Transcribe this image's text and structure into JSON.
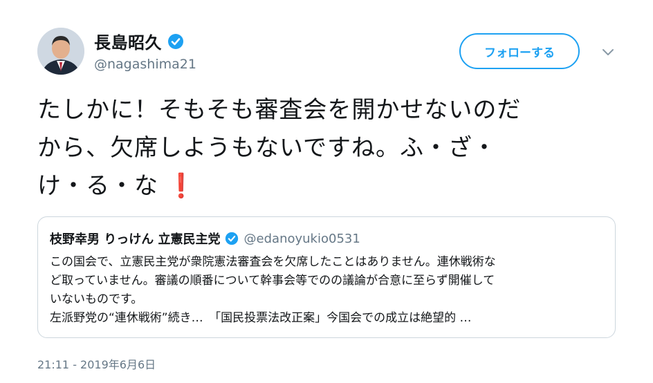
{
  "author": {
    "display_name": "長島昭久",
    "handle": "@nagashima21"
  },
  "follow_button_label": "フォローする",
  "tweet": {
    "lines": [
      "たしかに！そもそも審査会を開かせないのだ",
      "から、欠席しようもないですね。ふ・ざ・",
      "け・る・な"
    ],
    "emoji": "❗"
  },
  "quoted_tweet": {
    "display_name": "枝野幸男 りっけん 立憲民主党",
    "handle": "@edanoyukio0531",
    "lines": [
      "この国会で、立憲民主党が衆院憲法審査会を欠席したことはありません。連休戦術な",
      "ど取っていません。審議の順番について幹事会等でのの議論が合意に至らず開催して",
      "いないものです。",
      "左派野党の“連休戦術”続き…　「国民投票法改正案」今国会での成立は絶望的 …"
    ]
  },
  "timestamp": "21:11 - 2019年6月6日",
  "colors": {
    "accent": "#1da1f2",
    "text": "#14171a",
    "secondary": "#657786",
    "border": "#ccd6dd",
    "exclamation": "#dd2e44"
  },
  "icons": [
    "avatar-photo",
    "verified-badge-icon",
    "chevron-down-icon",
    "red-exclamation-emoji"
  ]
}
